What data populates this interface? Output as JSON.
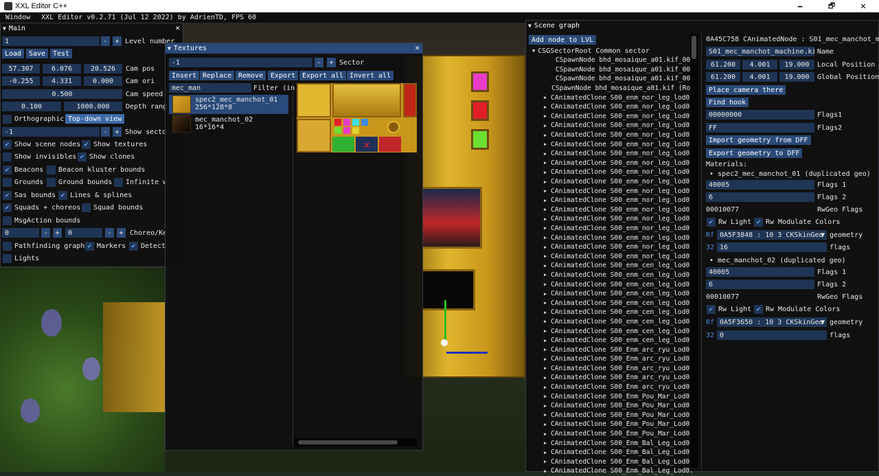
{
  "app": {
    "window_title": "XXL Editor C++",
    "menu_window": "Window",
    "status": "XXL Editor v0.2.71 (Jul 12 2022) by AdrienTD, FPS 60",
    "minimize": "🗕",
    "maximize": "🗗",
    "close": "✕"
  },
  "main": {
    "title": "Main",
    "level_value": "1",
    "level_label": "Level number",
    "load": "Load",
    "save": "Save",
    "test": "Test",
    "cam_pos": [
      "57.307",
      "6.076",
      "20.526"
    ],
    "cam_pos_label": "Cam pos",
    "cam_ori": [
      "-0.255",
      "4.331",
      "0.000"
    ],
    "cam_ori_label": "Cam ori",
    "cam_speed": "0.500",
    "cam_speed_label": "Cam speed",
    "depth": [
      "0.100",
      "1000.000"
    ],
    "depth_label": "Depth rang",
    "orthographic": "Orthographic",
    "topdown": "Top-down view",
    "sector_value": "-1",
    "sector_label": "Show secto",
    "show_scene_nodes": "Show scene nodes",
    "show_textures": "Show textures",
    "show_invisibles": "Show invisibles",
    "show_clones": "Show clones",
    "beacons": "Beacons",
    "beacon_kluster": "Beacon kluster bounds",
    "grounds": "Grounds",
    "ground_bounds": "Ground bounds",
    "infinite": "Infinite w",
    "sas_bounds": "Sas bounds",
    "lines_splines": "Lines & splines",
    "squads": "Squads + choreos",
    "squad_bounds": "Squad bounds",
    "msgaction": "MsgAction bounds",
    "choreo_a": "0",
    "choreo_b": "0",
    "choreo_label": "Choreo/Ke",
    "pathfinding": "Pathfinding graph",
    "markers": "Markers",
    "detect": "Detect",
    "lights": "Lights"
  },
  "textures": {
    "title": "Textures",
    "sector_value": "-1",
    "sector_label": "Sector",
    "insert": "Insert",
    "replace": "Replace",
    "remove": "Remove",
    "export": "Export",
    "export_all": "Export all",
    "invert_all": "Invert all",
    "filter_value": "mec_man",
    "filter_label": "Filter (in",
    "items": [
      {
        "name": "spec2_mec_manchot_01",
        "size": "256*128*8"
      },
      {
        "name": "mec_manchot_02",
        "size": "16*16*4"
      }
    ]
  },
  "scene_graph": {
    "title": "Scene graph",
    "add_node": "Add node to LVL",
    "root": "CSGSectorRoot Common sector",
    "nodes": [
      {
        "label": "CSpawnNode bhd_mosaique_a01.kif_002",
        "arrow": false
      },
      {
        "label": "CSpawnNode bhd_mosaique_a01.kif_001",
        "arrow": false
      },
      {
        "label": "CSpawnNode bhd_mosaique_a01.kif_000",
        "arrow": false
      },
      {
        "label": "CSpawnNode bhd_mosaique_a01.kif (Roc",
        "arrow": false
      },
      {
        "label": "CAnimatedClone S00_enm_nor_leg_lod0.",
        "arrow": true
      },
      {
        "label": "CAnimatedClone S00_enm_nor_leg_lod0.",
        "arrow": true
      },
      {
        "label": "CAnimatedClone S00_enm_nor_leg_lod0.",
        "arrow": true
      },
      {
        "label": "CAnimatedClone S00_enm_nor_leg_lod0.",
        "arrow": true
      },
      {
        "label": "CAnimatedClone S00_enm_nor_leg_lod0.",
        "arrow": true
      },
      {
        "label": "CAnimatedClone S00_enm_nor_leg_lod0.",
        "arrow": true
      },
      {
        "label": "CAnimatedClone S00_enm_nor_leg_lod0.",
        "arrow": true
      },
      {
        "label": "CAnimatedClone S00_enm_nor_leg_lod0.",
        "arrow": true
      },
      {
        "label": "CAnimatedClone S00_enm_nor_leg_lod0.",
        "arrow": true
      },
      {
        "label": "CAnimatedClone S00_enm_nor_leg_lod0.",
        "arrow": true
      },
      {
        "label": "CAnimatedClone S00_enm_nor_leg_lod0.",
        "arrow": true
      },
      {
        "label": "CAnimatedClone S00_enm_nor_leg_lod0.",
        "arrow": true
      },
      {
        "label": "CAnimatedClone S00_enm_nor_leg_lod0.",
        "arrow": true
      },
      {
        "label": "CAnimatedClone S00_enm_nor_leg_lod0.",
        "arrow": true
      },
      {
        "label": "CAnimatedClone S00_enm_nor_leg_lod0.",
        "arrow": true
      },
      {
        "label": "CAnimatedClone S00_enm_nor_leg_lod0.",
        "arrow": true
      },
      {
        "label": "CAnimatedClone S00_enm_nor_leg_lod0.",
        "arrow": true
      },
      {
        "label": "CAnimatedClone S00_enm_nor_leg_lod0.",
        "arrow": true
      },
      {
        "label": "CAnimatedClone S00_enm_cen_leg_lod0.",
        "arrow": true
      },
      {
        "label": "CAnimatedClone S00_enm_cen_leg_lod0.",
        "arrow": true
      },
      {
        "label": "CAnimatedClone S00_enm_cen_leg_lod0.",
        "arrow": true
      },
      {
        "label": "CAnimatedClone S00_enm_cen_leg_lod0.",
        "arrow": true
      },
      {
        "label": "CAnimatedClone S00_enm_cen_leg_lod0.",
        "arrow": true
      },
      {
        "label": "CAnimatedClone S00_enm_cen_leg_lod0.",
        "arrow": true
      },
      {
        "label": "CAnimatedClone S00_enm_cen_leg_lod0.",
        "arrow": true
      },
      {
        "label": "CAnimatedClone S00_enm_cen_leg_lod0.",
        "arrow": true
      },
      {
        "label": "CAnimatedClone S00_enm_cen_leg_lod0.",
        "arrow": true
      },
      {
        "label": "CAnimatedClone S00_Enm_arc_ryu_Lod0.",
        "arrow": true
      },
      {
        "label": "CAnimatedClone S00_Enm_arc_ryu_Lod0.",
        "arrow": true
      },
      {
        "label": "CAnimatedClone S00_Enm_arc_ryu_Lod0.",
        "arrow": true
      },
      {
        "label": "CAnimatedClone S00_Enm_arc_ryu_Lod0.",
        "arrow": true
      },
      {
        "label": "CAnimatedClone S00_Enm_arc_ryu_Lod0.",
        "arrow": true
      },
      {
        "label": "CAnimatedClone S00_Enm_Pou_Mar_Lod0.",
        "arrow": true
      },
      {
        "label": "CAnimatedClone S00_Enm_Pou_Mar_Lod0.",
        "arrow": true
      },
      {
        "label": "CAnimatedClone S00_Enm_Pou_Mar_Lod0.",
        "arrow": true
      },
      {
        "label": "CAnimatedClone S00_Enm_Pou_Mar_Lod0.",
        "arrow": true
      },
      {
        "label": "CAnimatedClone S00_Enm_Pou_Mar_Lod0.",
        "arrow": true
      },
      {
        "label": "CAnimatedClone S00_Enm_Bal_Leg_Lod0.",
        "arrow": true
      },
      {
        "label": "CAnimatedClone S00_Enm_Bal_Leg_Lod0.",
        "arrow": true
      },
      {
        "label": "CAnimatedClone S00_Enm_Bal_Leg_Lod0.",
        "arrow": true
      },
      {
        "label": "CAnimatedClone S00_Enm_Bal_Leg_Lod0.",
        "arrow": true
      }
    ]
  },
  "props": {
    "header": "0A45C758 CAnimatedNode : S01_mec_manchot_mac",
    "name_value": "S01_mec_manchot_machine.kif",
    "name_label": "Name",
    "local_pos": [
      "61.200",
      "4.001",
      "19.000"
    ],
    "local_label": "Local Position",
    "global_pos": [
      "61.200",
      "4.001",
      "19.000"
    ],
    "global_label": "Global Position",
    "place_camera": "Place camera there",
    "find_hook": "Find hook",
    "flags1_value": "00000000",
    "flags1_label": "Flags1",
    "flags2_value": "FF",
    "flags2_label": "Flags2",
    "import_geo": "Import geometry from DFF",
    "export_geo": "Export geometry to DFF",
    "materials_label": "Materials:",
    "mat1_title": "spec2_mec_manchot_01 (duplicated geo)",
    "mat1_flags1": "40005",
    "mat1_flags1_label": "Flags 1",
    "mat1_flags2": "6",
    "mat1_flags2_label": "Flags 2",
    "mat1_rwgeo": "00010077",
    "mat1_rwgeo_label": "RwGeo Flags",
    "rw_light": "Rw Light",
    "rw_modulate": "Rw Modulate Colors",
    "rf": "Rf",
    "mat1_geometry": "0A5F3848 : 10 3 CKSkinGeo",
    "geometry_label": "geometry",
    "mat1_num": "32",
    "mat1_flags_value": "16",
    "flags_label": "flags",
    "mat2_title": "mec_manchot_02 (duplicated geo)",
    "mat2_flags1": "40005",
    "mat2_flags2": "6",
    "mat2_rwgeo": "00010077",
    "mat2_geometry": "0A5F3650 : 10 3 CKSkinGeo",
    "mat2_num": "32",
    "mat2_flags_value": "0"
  }
}
